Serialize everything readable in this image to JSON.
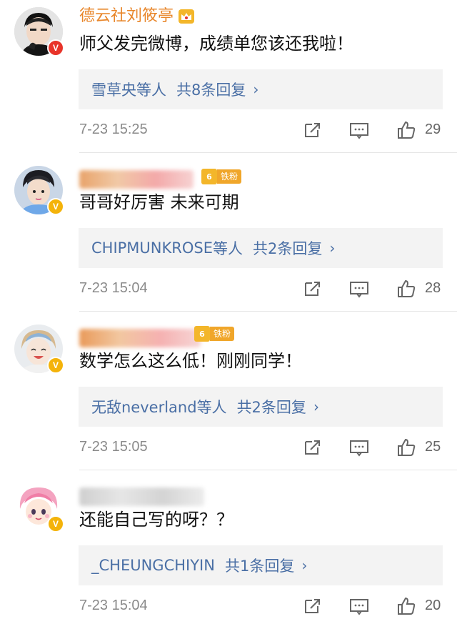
{
  "comments": [
    {
      "username": "德云社刘筱亭",
      "badge_color": "#e8342a",
      "text": "师父发完微博，成绩单您该还我啦！",
      "replies_who": "雪草央",
      "replies_suffix": "等人",
      "replies_total": "共8条回复",
      "time": "7-23 15:25",
      "likes": "29"
    },
    {
      "username": "",
      "fan_level": "6",
      "fan_label": "铁粉",
      "badge_color": "#f4b30a",
      "text": "哥哥好厉害  未来可期",
      "replies_who": "CHIPMUNKROSE",
      "replies_suffix": "等人",
      "replies_total": "共2条回复",
      "time": "7-23 15:04",
      "likes": "28"
    },
    {
      "username": "",
      "fan_level": "6",
      "fan_label": "铁粉",
      "badge_color": "#f4b30a",
      "text": "数学怎么这么低！刚刚同学！",
      "replies_who": "无敌neverland",
      "replies_suffix": "等人",
      "replies_total": "共2条回复",
      "time": "7-23 15:05",
      "likes": "25"
    },
    {
      "username": "",
      "badge_color": "#f4b30a",
      "text": "还能自己写的呀？？",
      "replies_who": "_CHEUNGCHIYIN",
      "replies_suffix": "",
      "replies_total": "共1条回复",
      "time": "7-23 15:04",
      "likes": "20"
    }
  ],
  "icons": {
    "reply_arrow": "›",
    "share": "share-icon",
    "comment": "comment-icon",
    "like": "like-icon",
    "verified": "V"
  }
}
